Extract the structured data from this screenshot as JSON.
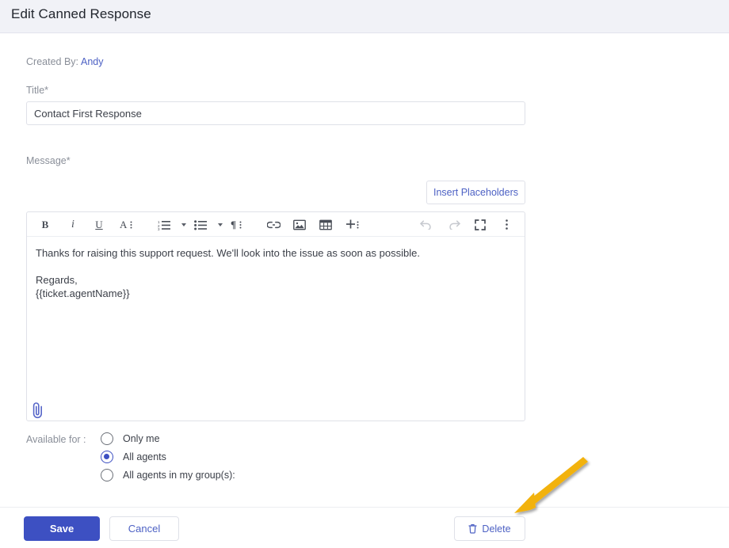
{
  "header": {
    "title": "Edit Canned Response"
  },
  "form": {
    "created_by_label": "Created By:",
    "created_by_user": "Andy",
    "title_label": "Title*",
    "title_value": "Contact First Response",
    "title_placeholder": "Title",
    "message_label": "Message*",
    "insert_placeholders_label": "Insert Placeholders",
    "available_for_label": "Available for :"
  },
  "editor": {
    "toolbar": [
      {
        "name": "bold-icon",
        "label": "B"
      },
      {
        "name": "italic-icon",
        "label": "i"
      },
      {
        "name": "underline-icon",
        "label": "U"
      },
      {
        "name": "font-size-icon",
        "label": "A"
      },
      {
        "name": "ordered-list-icon",
        "label": ""
      },
      {
        "name": "ordered-list-dropdown-icon",
        "label": ""
      },
      {
        "name": "unordered-list-icon",
        "label": ""
      },
      {
        "name": "unordered-list-dropdown-icon",
        "label": ""
      },
      {
        "name": "line-height-icon",
        "label": ""
      },
      {
        "name": "link-icon",
        "label": ""
      },
      {
        "name": "image-icon",
        "label": ""
      },
      {
        "name": "table-icon",
        "label": ""
      },
      {
        "name": "insert-more-icon",
        "label": ""
      },
      {
        "name": "undo-icon",
        "label": ""
      },
      {
        "name": "redo-icon",
        "label": ""
      },
      {
        "name": "fullscreen-icon",
        "label": ""
      },
      {
        "name": "more-options-icon",
        "label": ""
      }
    ],
    "body_line_1": "Thanks for raising this support request. We'll look into the issue as soon as possible.",
    "body_line_2": "Regards,",
    "body_line_3": "{{ticket.agentName}}"
  },
  "attachment": {
    "icon": "paperclip-icon"
  },
  "available_for": {
    "options": [
      {
        "label": "Only me",
        "selected": false
      },
      {
        "label": "All agents",
        "selected": true
      },
      {
        "label": "All agents in my group(s):",
        "selected": false
      }
    ]
  },
  "footer": {
    "save_label": "Save",
    "cancel_label": "Cancel",
    "delete_label": "Delete",
    "delete_icon": "trash-icon"
  },
  "annotation": {
    "type": "arrow",
    "color": "#f2b211",
    "points_to": "delete-button"
  },
  "colors": {
    "accent": "#3d50c2",
    "link": "#4d61c4",
    "header_bg": "#f1f2f7",
    "border": "#dfe1e8",
    "label_text": "#8a8f99",
    "body_text": "#3c4049",
    "annotation": "#f2b211"
  }
}
